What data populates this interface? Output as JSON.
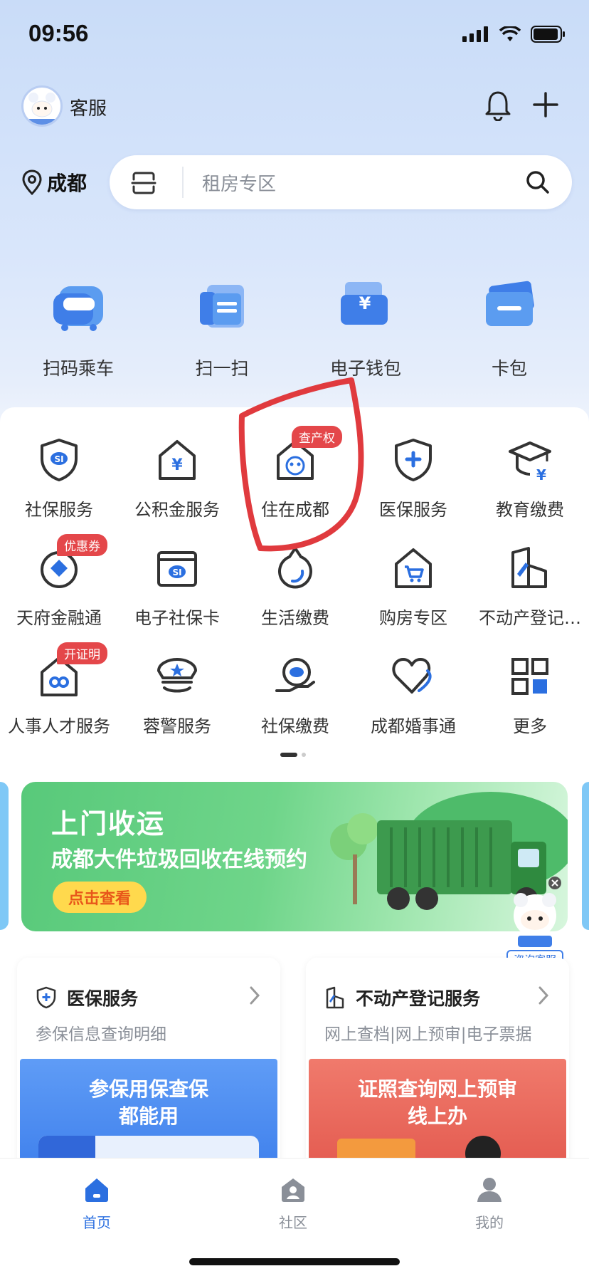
{
  "status": {
    "time": "09:56"
  },
  "header": {
    "service_label": "客服"
  },
  "location": {
    "city": "成都"
  },
  "search": {
    "placeholder": "租房专区"
  },
  "quick_actions": [
    {
      "label": "扫码乘车",
      "icon": "bus-icon"
    },
    {
      "label": "扫一扫",
      "icon": "scan-icon"
    },
    {
      "label": "电子钱包",
      "icon": "wallet-icon"
    },
    {
      "label": "卡包",
      "icon": "card-icon"
    }
  ],
  "services": [
    {
      "label": "社保服务",
      "icon": "shield-si-icon"
    },
    {
      "label": "公积金服务",
      "icon": "house-yuan-icon"
    },
    {
      "label": "住在成都",
      "icon": "panda-house-icon",
      "badge": "查产权"
    },
    {
      "label": "医保服务",
      "icon": "shield-plus-icon"
    },
    {
      "label": "教育缴费",
      "icon": "graduation-cap-icon"
    },
    {
      "label": "天府金融通",
      "icon": "diamond-circle-icon",
      "badge": "优惠券"
    },
    {
      "label": "电子社保卡",
      "icon": "si-card-icon"
    },
    {
      "label": "生活缴费",
      "icon": "water-drop-icon"
    },
    {
      "label": "购房专区",
      "icon": "house-cart-icon"
    },
    {
      "label": "不动产登记…",
      "icon": "building-pen-icon"
    },
    {
      "label": "人事人才服务",
      "icon": "house-infinity-icon",
      "badge": "开证明"
    },
    {
      "label": "蓉警服务",
      "icon": "police-cap-icon"
    },
    {
      "label": "社保缴费",
      "icon": "hand-si-icon"
    },
    {
      "label": "成都婚事通",
      "icon": "heart-icon"
    },
    {
      "label": "更多",
      "icon": "grid-more-icon"
    }
  ],
  "banner": {
    "title": "上门收运",
    "subtitle": "成都大件垃圾回收在线预约",
    "button": "点击查看"
  },
  "fab": {
    "label": "咨询客服"
  },
  "cards": [
    {
      "title": "医保服务",
      "subtitle": "参保信息查询明细",
      "promo_line1": "参保用保查保",
      "promo_line2": "都能用",
      "promo_color": "#4a8af0"
    },
    {
      "title": "不动产登记服务",
      "subtitle": "网上查档|网上预审|电子票据",
      "promo_line1": "证照查询网上预审",
      "promo_line2": "线上办",
      "promo_color": "#ec6a5e"
    }
  ],
  "tabbar": [
    {
      "label": "首页",
      "active": true
    },
    {
      "label": "社区",
      "active": false
    },
    {
      "label": "我的",
      "active": false
    }
  ],
  "colors": {
    "accent": "#2b6fe0",
    "badge": "#e4474a",
    "annotation": "#e03a3e"
  }
}
